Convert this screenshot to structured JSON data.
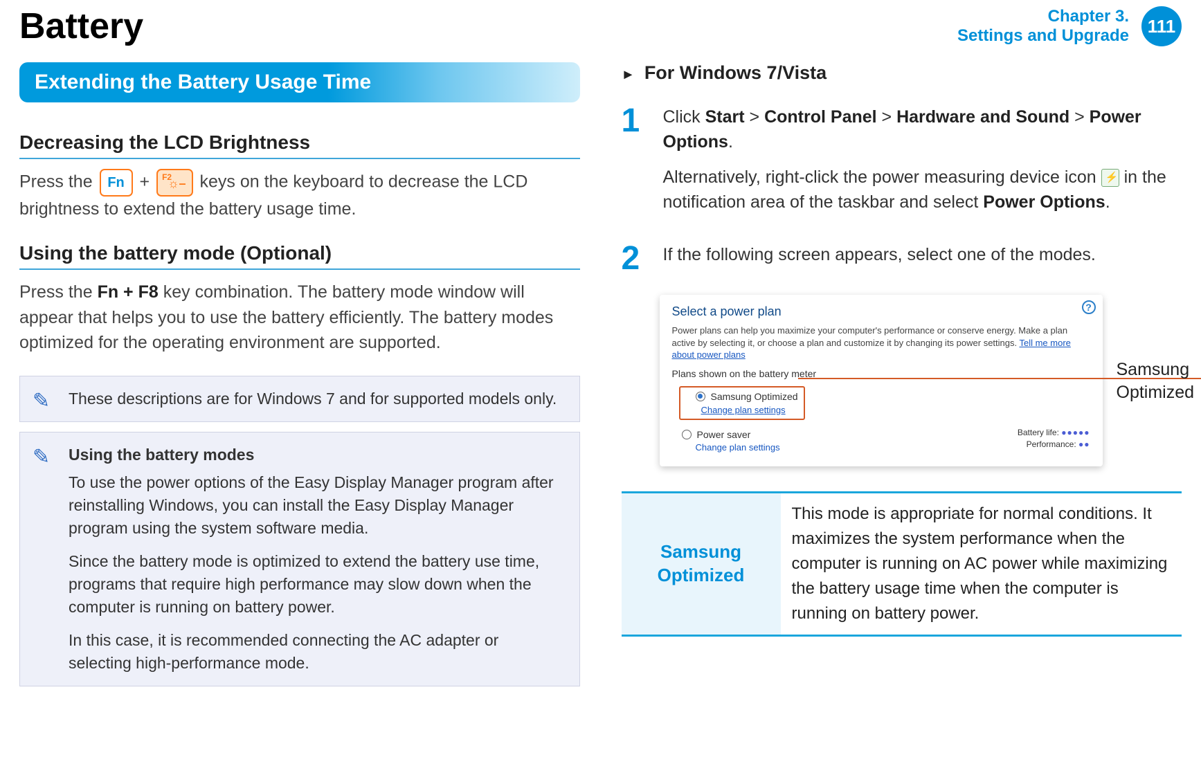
{
  "header": {
    "title": "Battery",
    "chapter_line1": "Chapter 3.",
    "chapter_line2": "Settings and Upgrade",
    "page_number": "111"
  },
  "left": {
    "banner": "Extending the Battery Usage Time",
    "h1": "Decreasing the LCD Brightness",
    "p1_pre": "Press the ",
    "fn_key": "Fn",
    "plus": " + ",
    "f2_sup": "F2",
    "f2_icon": "☼–",
    "p1_post": " keys on the keyboard to decrease the LCD brightness to extend the battery usage time.",
    "h2": "Using the battery mode (Optional)",
    "p2_a": "Press the ",
    "p2_bold": "Fn + F8",
    "p2_b": " key combination. The battery mode window will appear that helps you to use the battery efficiently. The battery modes optimized for the operating environment are supported.",
    "note1": "These descriptions are for Windows 7 and for supported models only.",
    "note2_title": "Using the battery modes",
    "note2_p1": "To use the power options of the Easy Display Manager program after reinstalling Windows, you can install the Easy Display Manager program using the system software media.",
    "note2_p2": "Since the battery mode is optimized to extend the battery use time, programs that require high performance may slow down when the computer is running on battery power.",
    "note2_p3": "In this case, it is recommended connecting the AC adapter or selecting high-performance mode."
  },
  "right": {
    "heading_prefix": "►",
    "heading": "For Windows 7/Vista",
    "step1_num": "1",
    "step1_a": "Click ",
    "step1_b1": "Start",
    "gt1": " > ",
    "step1_b2": "Control Panel",
    "gt2": " > ",
    "step1_b3": "Hardware and Sound",
    "gt3": " > ",
    "step1_b4": "Power Options",
    "step1_end": ".",
    "step1_p2a": "Alternatively, right-click the power measuring device icon ",
    "step1_p2b": " in the notification area of the taskbar and select ",
    "step1_p2c": "Power Options",
    "step1_p2d": ".",
    "step2_num": "2",
    "step2": "If the following screen appears, select one of the modes.",
    "shot": {
      "title": "Select a power plan",
      "desc_a": "Power plans can help you maximize your computer's performance or conserve energy. Make a plan active by selecting it, or choose a plan and customize it by changing its power settings. ",
      "desc_link": "Tell me more about power plans",
      "sub": "Plans shown on the battery meter",
      "plan1": "Samsung Optimized",
      "change": "Change plan settings",
      "plan2": "Power saver",
      "batt_label": "Battery life:",
      "perf_label": "Performance:",
      "batt_dots": "●●●●●",
      "perf_dots": "●●"
    },
    "callout": "Samsung Optimized",
    "table": {
      "left": "Samsung Optimized",
      "right": "This mode is appropriate for normal conditions. It maximizes the system performance when the computer is running on AC power while maximizing the battery usage time when the computer is running on battery power."
    }
  }
}
